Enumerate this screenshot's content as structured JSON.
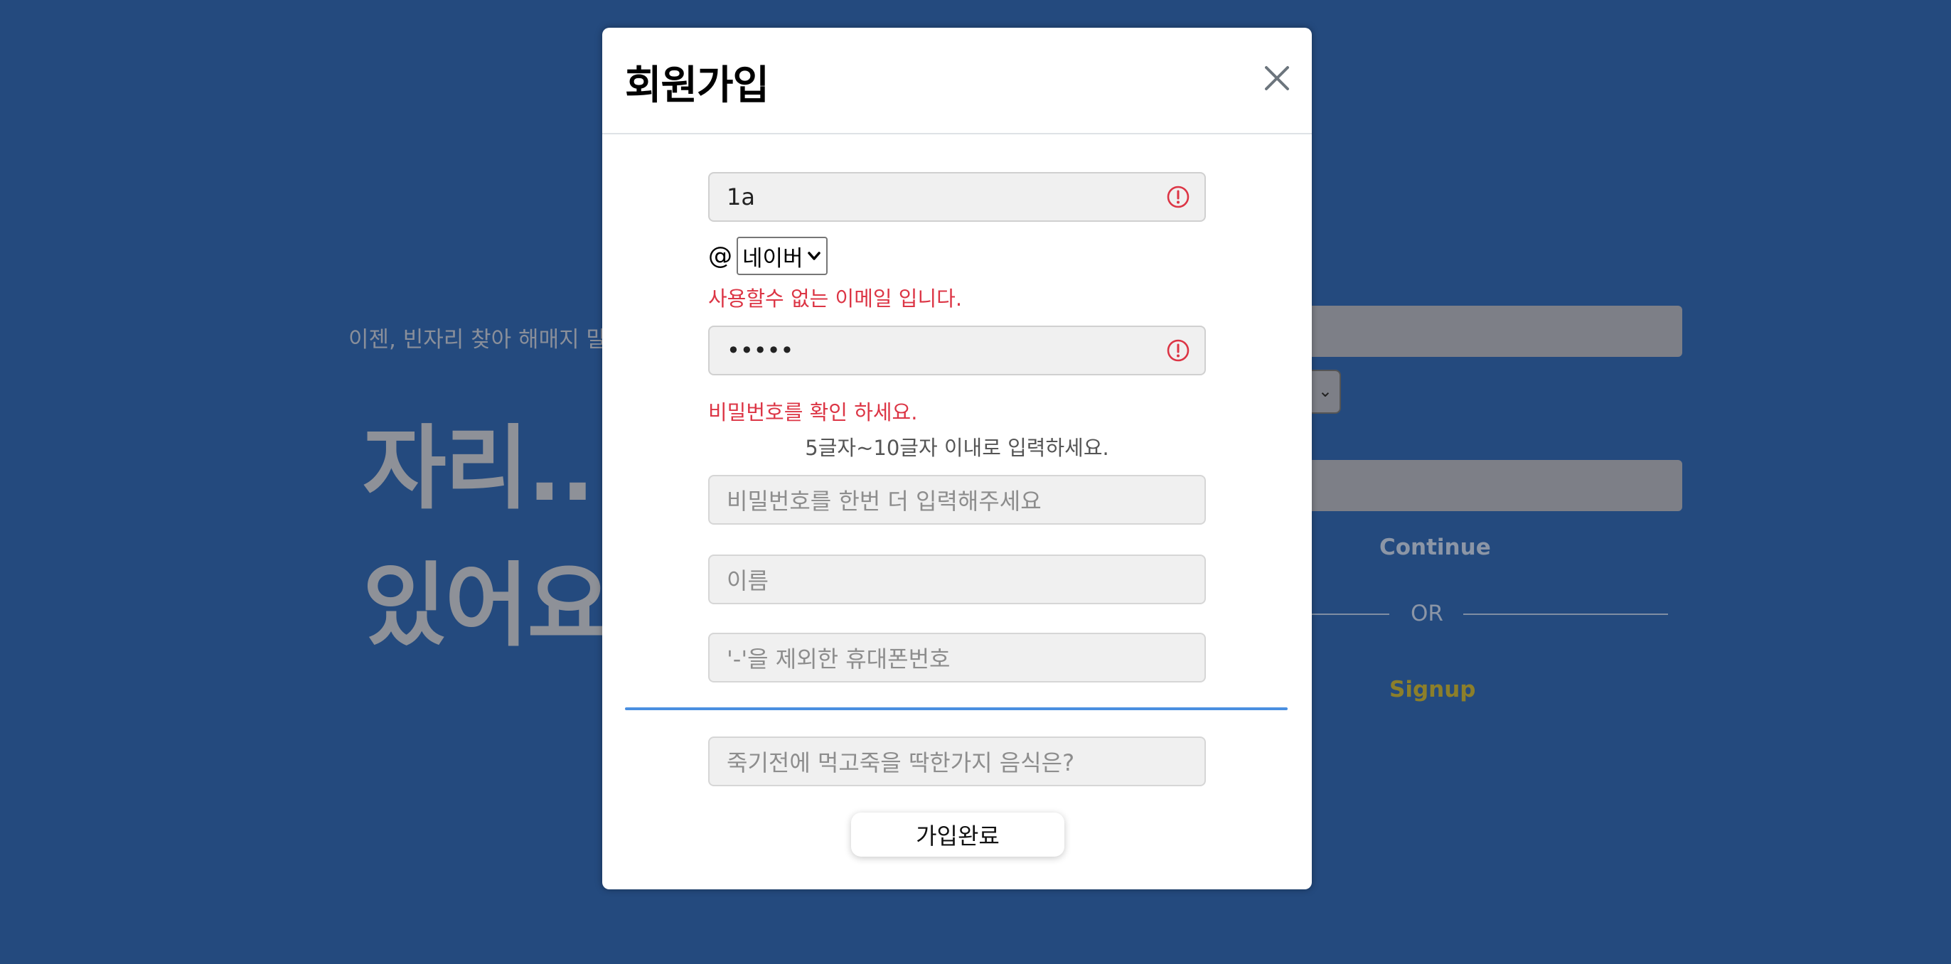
{
  "background": {
    "subtitle": "이젠, 빈자리 찾아 해매지 말고",
    "hero_line1": "자리..",
    "hero_line2": "있어요?",
    "continue_label": "Continue",
    "or_label": "OR",
    "signup_label": "Signup"
  },
  "modal": {
    "title": "회원가입",
    "close_icon": "close-icon",
    "email_id_value": "1a",
    "at_sign": "@",
    "domain_selected": "네이버",
    "email_error": "사용할수 없는 이메일 입니다.",
    "password_value": "•••••",
    "password_error": "비밀번호를 확인 하세요.",
    "password_hint": "5글자~10글자 이내로 입력하세요.",
    "password_confirm_placeholder": "비밀번호를 한번 더 입력해주세요",
    "name_placeholder": "이름",
    "phone_placeholder": "'-'을 제외한 휴대폰번호",
    "question_placeholder": "죽기전에 먹고죽을 딱한가지 음식은?",
    "submit_label": "가입완료"
  },
  "colors": {
    "page_background": "#244a7e",
    "error": "#dc3545",
    "divider": "#4a8fe0"
  }
}
